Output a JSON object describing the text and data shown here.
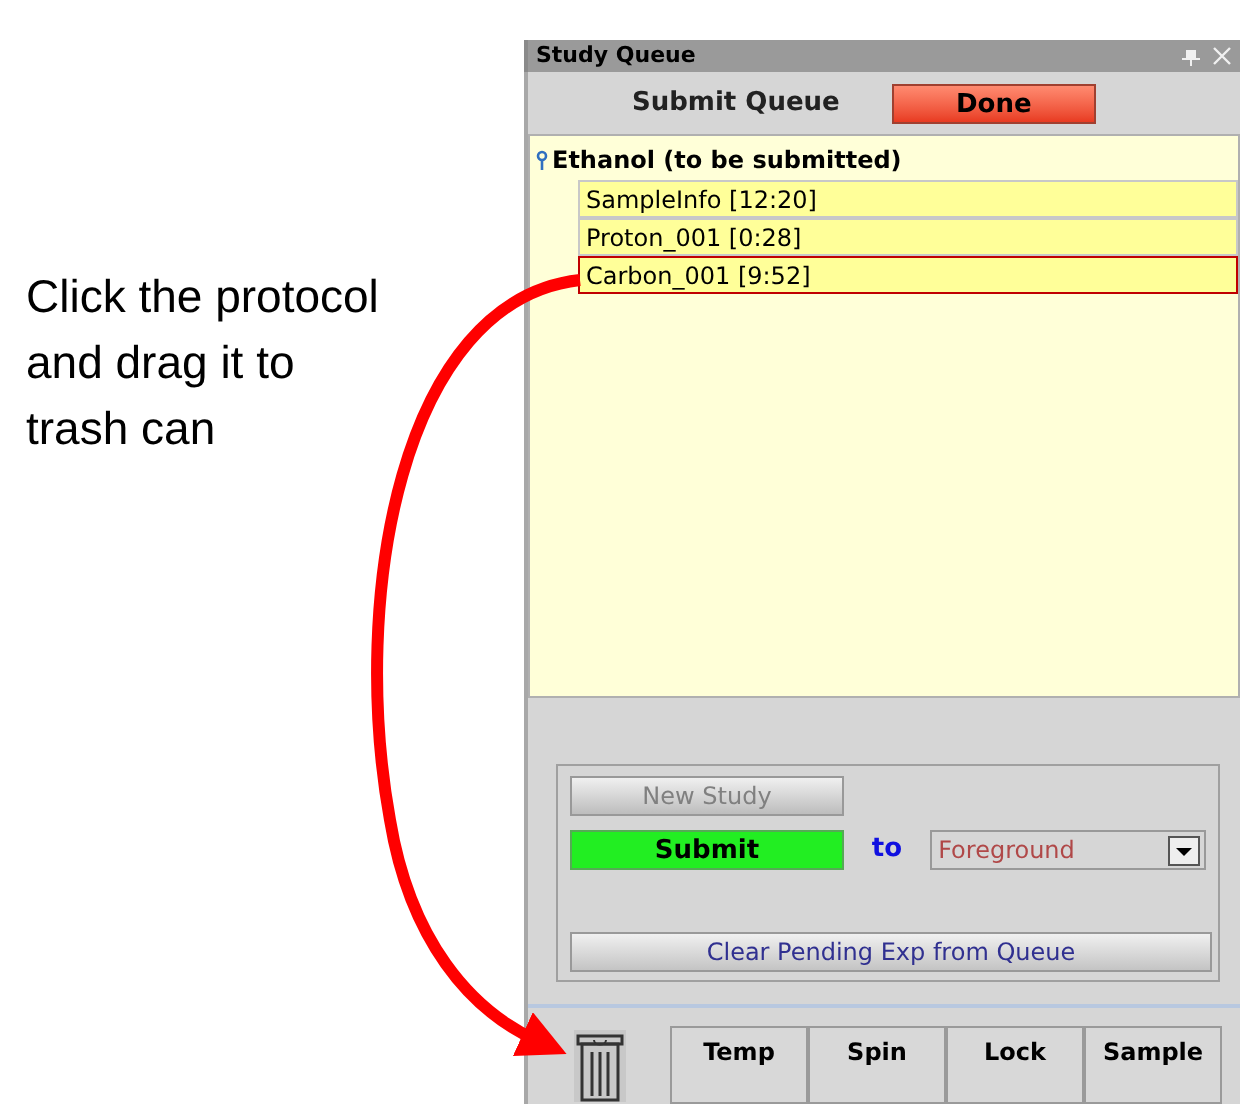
{
  "annotation": {
    "text": "Click the protocol\nand drag it to\ntrash can"
  },
  "panel": {
    "title": "Study Queue"
  },
  "header": {
    "label": "Submit Queue",
    "done_button": "Done"
  },
  "queue": {
    "study": "Ethanol (to be submitted)",
    "items": [
      {
        "label": "SampleInfo [12:20]",
        "selected": false
      },
      {
        "label": "Proton_001 [0:28]",
        "selected": false
      },
      {
        "label": "Carbon_001 [9:52]",
        "selected": true
      }
    ]
  },
  "controls": {
    "new_study": {
      "label": "New Study",
      "disabled": true
    },
    "submit": "Submit",
    "to": "to",
    "destination": "Foreground",
    "clear": "Clear Pending Exp from Queue"
  },
  "toolbar": {
    "buttons": [
      "Temp",
      "Spin",
      "Lock",
      "Sample"
    ]
  }
}
